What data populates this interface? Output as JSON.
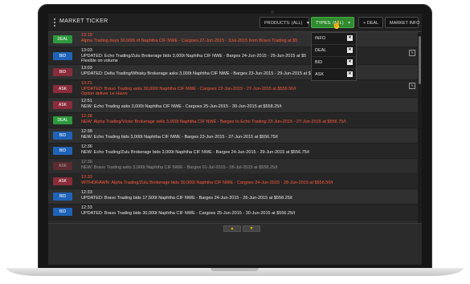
{
  "header": {
    "title": "MARKET TICKER",
    "products_label": "PRODUCTS: (ALL)",
    "types_label": "TYPES: (ALL)",
    "deal_label": "+ DEAL",
    "market_info_label": "MARKET INFO",
    "caret": "▾"
  },
  "types_menu": {
    "options": [
      {
        "label": "INFO",
        "checked": "✕"
      },
      {
        "label": "DEAL",
        "checked": "✕"
      },
      {
        "label": "BID",
        "checked": "✕"
      },
      {
        "label": "ASK",
        "checked": "✕"
      }
    ]
  },
  "rows": [
    {
      "badge": "DEAL",
      "time": "13:18",
      "line1": "Alpha Trading buys 30,000t of Naphtha CIF NWE - Cargoes 27-Jun-2015 - 3Jul-2015 from Bravo Trading at $5",
      "line2": ""
    },
    {
      "badge": "BID",
      "time": "13:03",
      "line1": "UPDATED: Echo Trading/Zulu Brokerage bids 3,000t Naphtha CIF NWE - Barges 24-Jun-2015 - 29-Jun-2015 at $5",
      "line2": "Flexible on volume"
    },
    {
      "badge": "BID",
      "time": "13:03",
      "line1": "UPDATED: Delta Trading/Whisky Brokerage asks 3,000t Naphtha CIF NWE - Barges 23-Jun-2015 - 29-Jun-2015 at $558.25/t",
      "line2": ""
    },
    {
      "badge": "ASK",
      "time": "13:21",
      "line1": "UPDATED: Bravo Trading asks 30,000t Naphtha CIF NWE - Cargoes 22-Jun-2015 - 27-Jun-2015 at $559.50/t",
      "line2": "Option deliver Le Havre"
    },
    {
      "badge": "ASK",
      "time": "12:51",
      "line1": "NEW: Echo Trading asks 3,000t Naphtha CIF NWE - Cargoes 25-Jun-2015 - 30-Jun-2015 at $558.25/t",
      "line2": ""
    },
    {
      "badge": "DEAL",
      "time": "12:38",
      "line1": "NEW: Alpha Trading/Victor Brokerage sells 3,000t Naphtha CIF NWE - Barges to Echo Trading 23-Jun-2015 - 27-Jun-2015 at $556.75/t",
      "line2": ""
    },
    {
      "badge": "BID",
      "time": "12:38",
      "line1": "NEW: Echo Trading bids 3,000t Naphtha CIF NWE - Barges 23-Jun-2015 - 27-Jun-2015 at $556.75/t",
      "line2": ""
    },
    {
      "badge": "BID",
      "time": "12:36",
      "line1": "NEW: Echo Trading/Zulu Brokerage bids 3,000t Naphtha CIF NWE - Barges 24-Jun-2015 - 29-Jun-2015 at $556.75/t",
      "line2": ""
    },
    {
      "badge": "ASK",
      "time": "12:36",
      "line1": "NEW: Bravo Trading asks 3,000t Naphtha CIF NWE - Barges 01-Jul-2015 - 06-Jul-2015 at $558.25/t",
      "line2": ""
    },
    {
      "badge": "ASK",
      "time": "12:33",
      "line1": "WITHDRAWN: Alpha Trading/Zulu Brokerage bids 30,000t Naphtha CIF NWE - Cargoes 24-Jun-2015 - 28-Jun-2015 at $556.50/t",
      "line2": ""
    },
    {
      "badge": "BID",
      "time": "12:33",
      "line1": "UPDATED: Bravo Trading bids 17,500t Naphtha CIF NWE - Barges 24-Jun-2015 - 26-Jun-2015 at $558.25/t",
      "line2": ""
    },
    {
      "badge": "BID",
      "time": "12:33",
      "line1": "UPDATED: Bravo Trading bids 30,000t Naphtha CIF NWE - Cargoes 25-Jun-2015 - 30-Jun-2015 at $556.25/t",
      "line2": ""
    }
  ],
  "pager": {
    "up": "▲",
    "down": "▼"
  },
  "colors": {
    "deal": "#2e9a3e",
    "bid": "#1f63b8",
    "ask": "#8a2c3a",
    "highlight_text": "#ff5a3c",
    "types_active": "#2e8b2e"
  }
}
